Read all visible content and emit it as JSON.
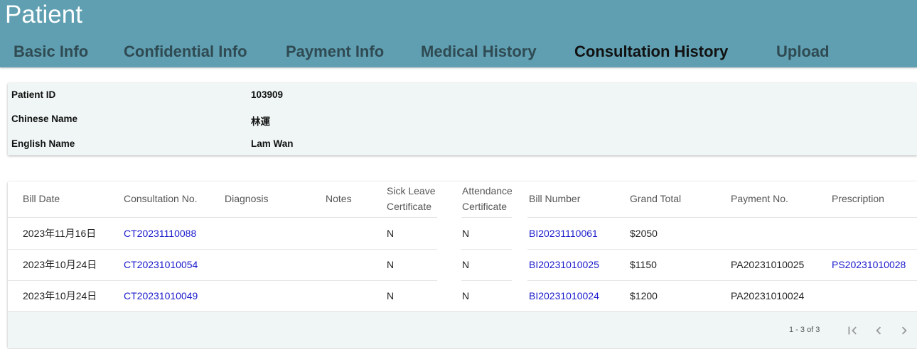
{
  "app": {
    "title": "Patient"
  },
  "tabs": [
    {
      "label": "Basic Info"
    },
    {
      "label": "Confidential Info"
    },
    {
      "label": "Payment Info"
    },
    {
      "label": "Medical History"
    },
    {
      "label": "Consultation History"
    },
    {
      "label": "Upload"
    }
  ],
  "active_tab": "Consultation History",
  "patient": {
    "id_label": "Patient ID",
    "id_value": "103909",
    "chinese_label": "Chinese Name",
    "chinese_value": "林運",
    "english_label": "English Name",
    "english_value": "Lam Wan"
  },
  "table": {
    "columns": {
      "bill_date": "Bill Date",
      "consultation_no": "Consultation No.",
      "diagnosis": "Diagnosis",
      "notes": "Notes",
      "sick_leave_1": "Sick Leave",
      "sick_leave_2": "Certificate",
      "attendance_1": "Attendance",
      "attendance_2": "Certificate",
      "bill_number": "Bill Number",
      "grand_total": "Grand Total",
      "payment_no": "Payment No.",
      "prescription": "Prescription"
    },
    "rows": [
      {
        "bill_date": "2023年11月16日",
        "consultation_no": "CT20231110088",
        "diagnosis": "",
        "notes": "",
        "sick_leave": "N",
        "attendance": "N",
        "bill_number": "BI20231110061",
        "grand_total": "$2050",
        "payment_no": "",
        "prescription": ""
      },
      {
        "bill_date": "2023年10月24日",
        "consultation_no": "CT20231010054",
        "diagnosis": "",
        "notes": "",
        "sick_leave": "N",
        "attendance": "N",
        "bill_number": "BI20231010025",
        "grand_total": "$1150",
        "payment_no": "PA20231010025",
        "prescription": "PS20231010028"
      },
      {
        "bill_date": "2023年10月24日",
        "consultation_no": "CT20231010049",
        "diagnosis": "",
        "notes": "",
        "sick_leave": "N",
        "attendance": "N",
        "bill_number": "BI20231010024",
        "grand_total": "$1200",
        "payment_no": "PA20231010024",
        "prescription": ""
      }
    ]
  },
  "pagination": {
    "range_text": "1 - 3 of 3"
  },
  "icons": {
    "first": "first-page-icon",
    "prev": "chevron-left-icon",
    "next": "chevron-right-icon"
  }
}
